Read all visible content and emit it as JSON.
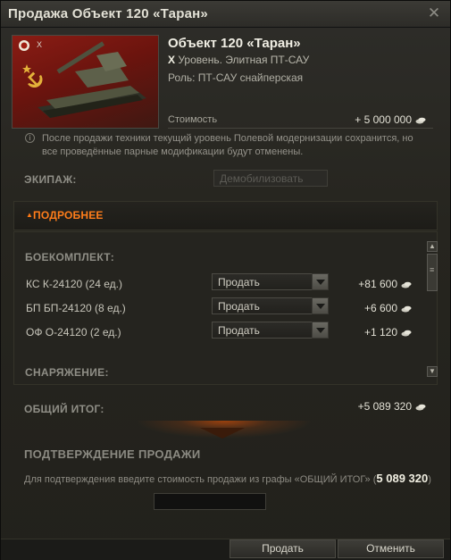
{
  "window": {
    "title": "Продажа Объект 120 «Таран»",
    "close_glyph": "✕"
  },
  "tank": {
    "name": "Объект 120 «Таран»",
    "level_num": "X",
    "level_text": " Уровень. Элитная ПТ-САУ",
    "role": "Роль: ПТ-САУ снайперская",
    "badge_level": "X",
    "cost_label": "Стоимость",
    "cost_value": "+ 5 000 000"
  },
  "notice": {
    "icon": "info-icon",
    "text": "После продажи техники текущий уровень Полевой модернизации сохранится, но все проведённые парные модификации будут отменены."
  },
  "crew": {
    "label": "ЭКИПАЖ:",
    "select_value": "Демобилизовать"
  },
  "details": {
    "toggle_label": "ПОДРОБНЕЕ"
  },
  "ammo": {
    "section_label": "БОЕКОМПЛЕКТ:",
    "rows": [
      {
        "name": "КС К-24120 (24 ед.)",
        "action": "Продать",
        "value": "+81 600"
      },
      {
        "name": "БП БП-24120 (8 ед.)",
        "action": "Продать",
        "value": "+6 600"
      },
      {
        "name": "ОФ О-24120 (2 ед.)",
        "action": "Продать",
        "value": "+1 120"
      }
    ]
  },
  "equipment": {
    "section_label": "СНАРЯЖЕНИЕ:"
  },
  "total": {
    "label": "ОБЩИЙ ИТОГ:",
    "value": "+5 089 320"
  },
  "confirm": {
    "title": "ПОДТВЕРЖДЕНИЕ ПРОДАЖИ",
    "text_prefix": "Для подтверждения введите стоимость продажи из графы «ОБЩИЙ ИТОГ» (",
    "amount": "5 089 320",
    "text_suffix": ")",
    "input_value": ""
  },
  "buttons": {
    "sell": "Продать",
    "cancel": "Отменить"
  },
  "colors": {
    "accent_orange": "#ff7d1a",
    "flag_red": "#8a1c14"
  }
}
